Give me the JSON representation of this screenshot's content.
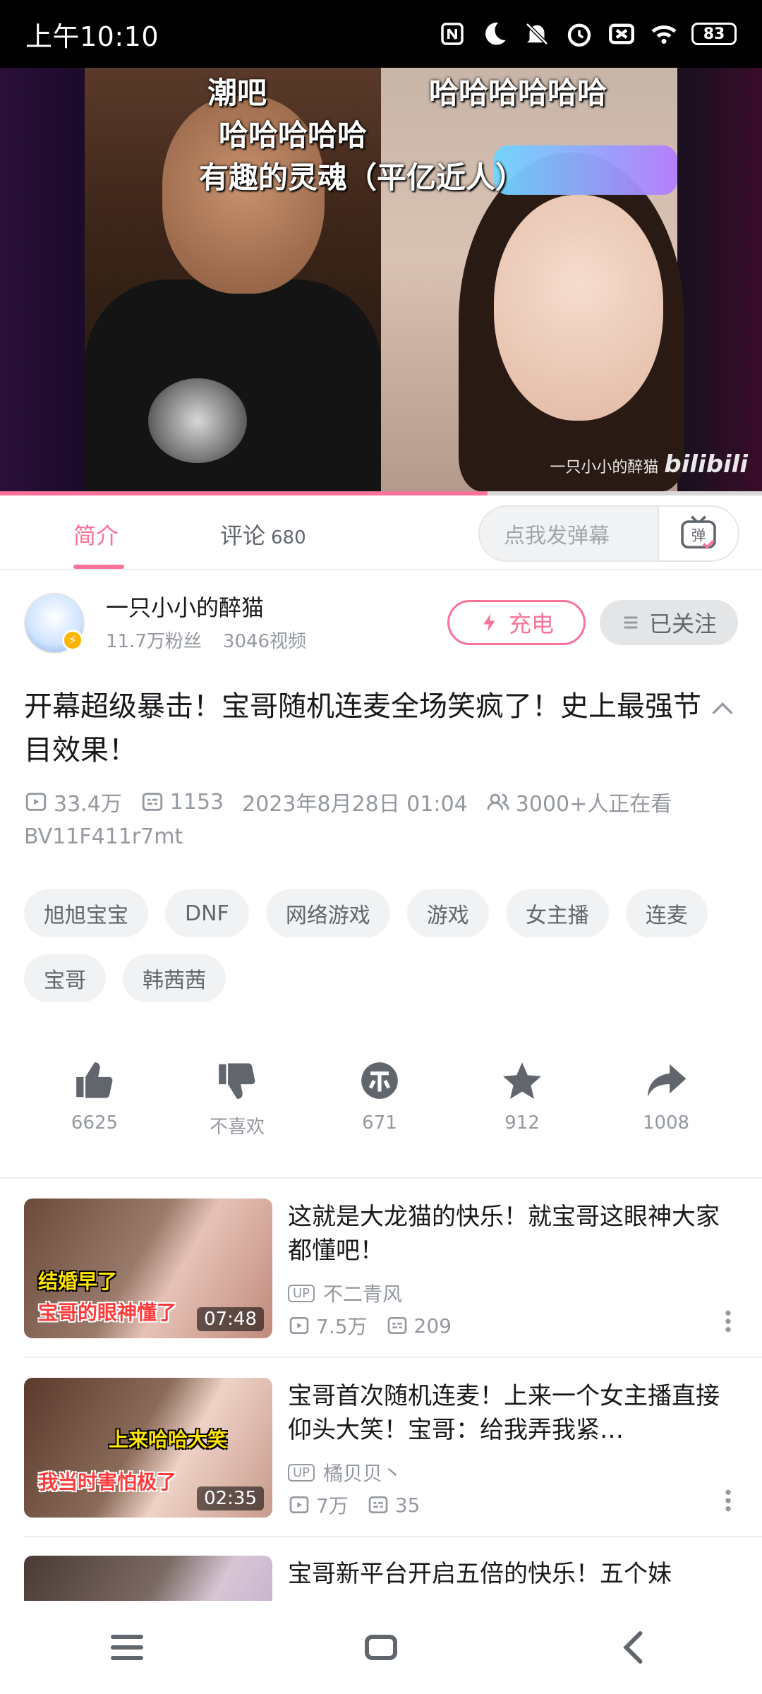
{
  "status_bar": {
    "time": "上午10:10",
    "battery": "83"
  },
  "video": {
    "danmaku": [
      "潮吧",
      "哈哈哈哈哈哈",
      "哈哈哈哈哈",
      "有趣的灵魂（平亿近人）"
    ],
    "watermark_user": "一只小小的醉猫",
    "watermark_logo": "bilibili",
    "progress_fraction": 0.64
  },
  "tabs": [
    {
      "label": "简介",
      "active": true
    },
    {
      "label": "评论",
      "count": "680",
      "active": false
    }
  ],
  "danmaku_input": {
    "placeholder": "点我发弹幕",
    "button_label": "弹"
  },
  "uploader": {
    "name": "一只小小的醉猫",
    "followers": "11.7万粉丝",
    "videos": "3046视频",
    "charge_label": "充电",
    "follow_label": "已关注"
  },
  "video_info": {
    "title": "开幕超级暴击！宝哥随机连麦全场笑疯了！史上最强节目效果！",
    "views": "33.4万",
    "danmaku_count": "1153",
    "date": "2023年8月28日 01:04",
    "watching": "3000+人正在看",
    "bvid": "BV11F411r7mt"
  },
  "tags": [
    "旭旭宝宝",
    "DNF",
    "网络游戏",
    "游戏",
    "女主播",
    "连麦",
    "宝哥",
    "韩茜茜"
  ],
  "actions": {
    "like": "6625",
    "dislike": "不喜欢",
    "coin": "671",
    "favorite": "912",
    "share": "1008"
  },
  "recommendations": [
    {
      "title": "这就是大龙猫的快乐！就宝哥这眼神大家都懂吧！",
      "up": "不二青风",
      "views": "7.5万",
      "danmaku": "209",
      "duration": "07:48",
      "overlay": [
        "结婚早了",
        "宝哥的眼神懂了"
      ]
    },
    {
      "title": "宝哥首次随机连麦！上来一个女主播直接仰头大笑！宝哥：给我弄我紧…",
      "up": "橘贝贝丶",
      "views": "7万",
      "danmaku": "35",
      "duration": "02:35",
      "overlay": [
        "上来哈哈大笑",
        "我当时害怕极了"
      ]
    },
    {
      "title": "宝哥新平台开启五倍的快乐！五个妹"
    }
  ],
  "up_badge": "UP",
  "colors": {
    "accent": "#fb7299",
    "text": "#18191c",
    "muted": "#9499a0"
  },
  "icons": {
    "nav": [
      "menu-icon",
      "home-square-icon",
      "back-icon"
    ]
  }
}
